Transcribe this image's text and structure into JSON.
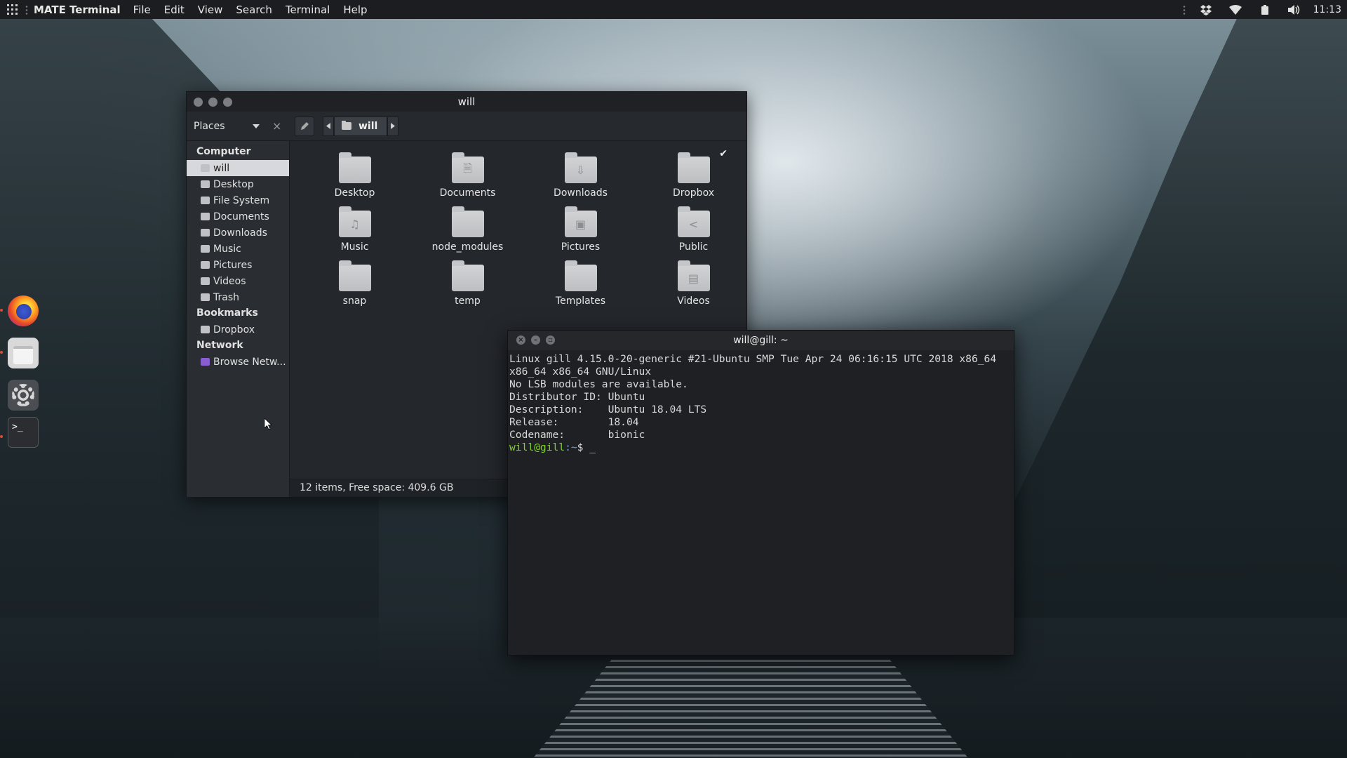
{
  "top_panel": {
    "app_name": "MATE Terminal",
    "menu": [
      "File",
      "Edit",
      "View",
      "Search",
      "Terminal",
      "Help"
    ],
    "clock": "11:13",
    "tray_icons": [
      "dropbox-icon",
      "wifi-icon",
      "battery-icon",
      "volume-icon"
    ]
  },
  "dock": {
    "items": [
      "firefox",
      "files",
      "settings",
      "terminal"
    ],
    "terminal_glyph": ">_"
  },
  "file_manager": {
    "title": "will",
    "places_label": "Places",
    "close_glyph": "×",
    "path": {
      "current": "will"
    },
    "sidebar": {
      "sections": [
        {
          "title": "Computer",
          "items": [
            "will",
            "Desktop",
            "File System",
            "Documents",
            "Downloads",
            "Music",
            "Pictures",
            "Videos",
            "Trash"
          ]
        },
        {
          "title": "Bookmarks",
          "items": [
            "Dropbox"
          ]
        },
        {
          "title": "Network",
          "items": [
            "Browse Netw..."
          ]
        }
      ],
      "selected": "will"
    },
    "files": [
      {
        "name": "Desktop",
        "glyph": ""
      },
      {
        "name": "Documents",
        "glyph": "🗎"
      },
      {
        "name": "Downloads",
        "glyph": "⇩"
      },
      {
        "name": "Dropbox",
        "glyph": ""
      },
      {
        "name": "Music",
        "glyph": "♫"
      },
      {
        "name": "node_modules",
        "glyph": ""
      },
      {
        "name": "Pictures",
        "glyph": "▣"
      },
      {
        "name": "Public",
        "glyph": "<"
      },
      {
        "name": "snap",
        "glyph": ""
      },
      {
        "name": "temp",
        "glyph": ""
      },
      {
        "name": "Templates",
        "glyph": ""
      },
      {
        "name": "Videos",
        "glyph": "▤"
      }
    ],
    "status": "12 items, Free space: 409.6 GB"
  },
  "terminal": {
    "title": "will@gill: ~",
    "lines": [
      "Linux gill 4.15.0-20-generic #21-Ubuntu SMP Tue Apr 24 06:16:15 UTC 2018 x86_64",
      "x86_64 x86_64 GNU/Linux",
      "No LSB modules are available.",
      "Distributor ID:\tUbuntu",
      "Description:\tUbuntu 18.04 LTS",
      "Release:\t18.04",
      "Codename:\tbionic"
    ],
    "prompt_user": "will@gill",
    "prompt_path": ":~",
    "prompt_suffix": "$ _"
  }
}
